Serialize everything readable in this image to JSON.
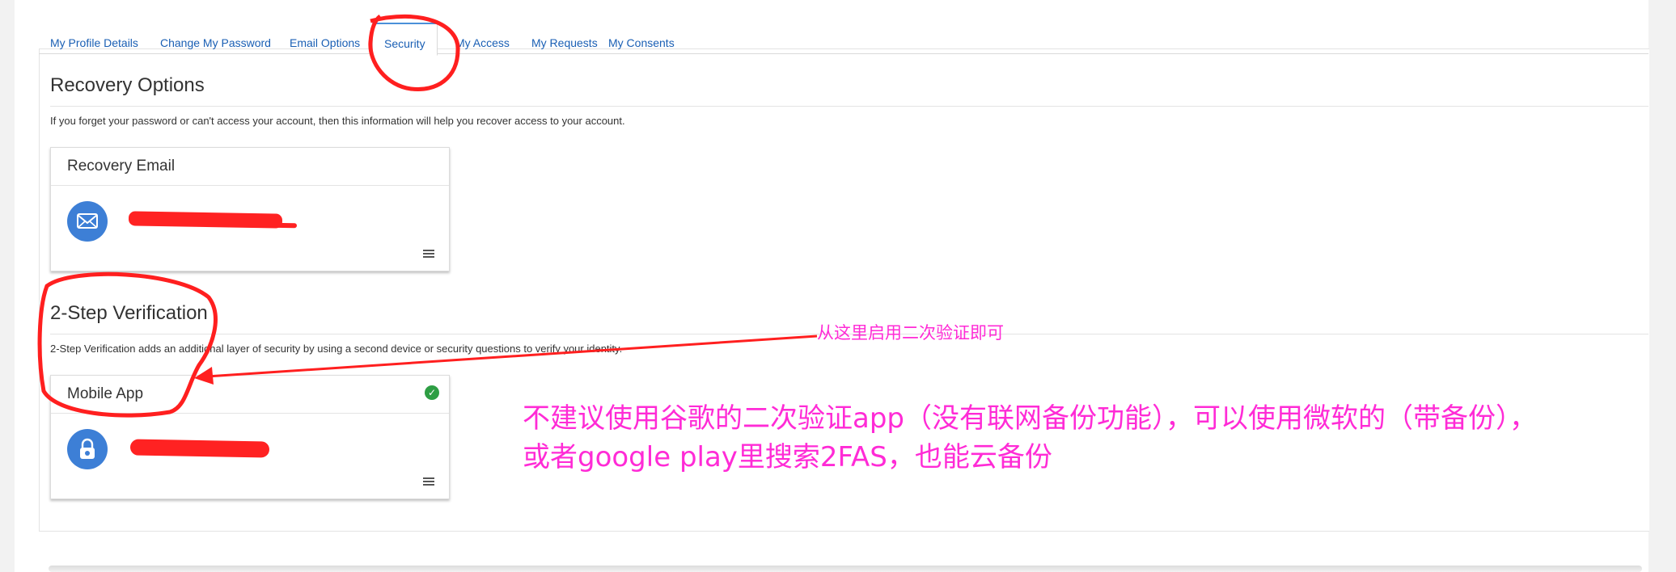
{
  "tabs": [
    {
      "label": "My Profile Details"
    },
    {
      "label": "Change My Password"
    },
    {
      "label": "Email Options"
    },
    {
      "label": "Security"
    },
    {
      "label": "My Access"
    },
    {
      "label": "My Requests"
    },
    {
      "label": "My Consents"
    }
  ],
  "active_tab": "Security",
  "recovery": {
    "title": "Recovery Options",
    "description": "If you forget your password or can't access your account, then this information will help you recover access to your account.",
    "card": {
      "title": "Recovery Email",
      "icon": "envelope-icon"
    }
  },
  "two_step": {
    "title": "2-Step Verification",
    "description": "2-Step Verification adds an additional layer of security by using a second device or security questions to verify your identity.",
    "card": {
      "title": "Mobile App",
      "icon": "lock-icon",
      "status_icon": "check-circle-icon"
    }
  },
  "annotations": {
    "arrow_note": "从这里启用二次验证即可",
    "note_line1": "不建议使用谷歌的二次验证app（没有联网备份功能），可以使用微软的（带备份），",
    "note_line2": "或者google play里搜索2FAS，也能云备份"
  },
  "colors": {
    "link": "#1a5fb4",
    "accent": "#3d7fd6",
    "success": "#2e9e44",
    "annotation": "#ff2bd6",
    "markup": "#ff2222"
  }
}
